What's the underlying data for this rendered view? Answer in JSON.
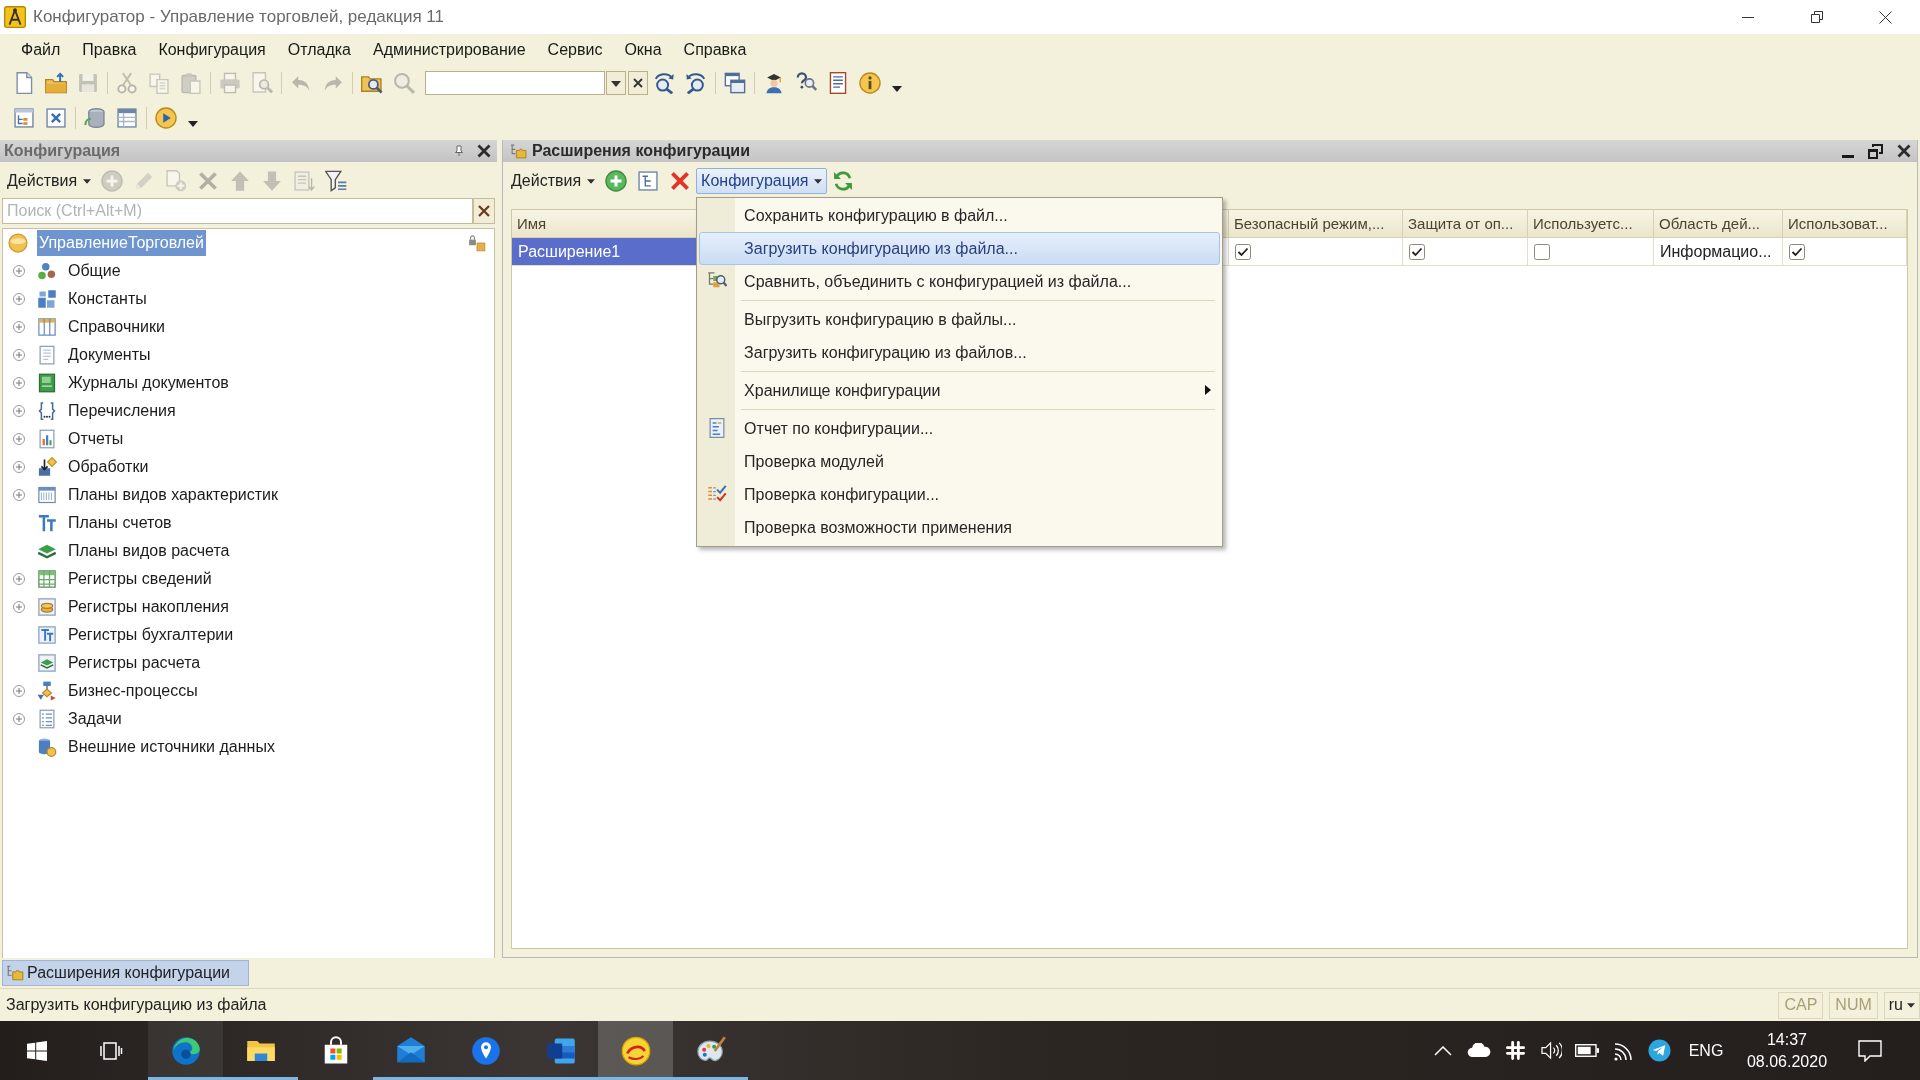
{
  "window": {
    "title": "Конфигуратор - Управление торговлей, редакция 11"
  },
  "menu_bar": [
    "Файл",
    "Правка",
    "Конфигурация",
    "Отладка",
    "Администрирование",
    "Сервис",
    "Окна",
    "Справка"
  ],
  "toolbar_main": [
    {
      "kind": "button",
      "disabled": false
    },
    {
      "kind": "button",
      "disabled": false
    },
    {
      "kind": "button",
      "disabled": true
    },
    {
      "kind": "separator"
    },
    {
      "kind": "button",
      "disabled": true
    },
    {
      "kind": "button",
      "disabled": true
    },
    {
      "kind": "button",
      "disabled": true
    },
    {
      "kind": "separator"
    },
    {
      "kind": "button",
      "disabled": true
    },
    {
      "kind": "button",
      "disabled": true
    },
    {
      "kind": "separator"
    },
    {
      "kind": "button",
      "disabled": true
    },
    {
      "kind": "button",
      "disabled": true
    },
    {
      "kind": "separator"
    },
    {
      "kind": "button",
      "disabled": false
    },
    {
      "kind": "button",
      "disabled": true
    },
    {
      "kind": "combo"
    },
    {
      "kind": "button",
      "disabled": false
    },
    {
      "kind": "button",
      "disabled": false
    },
    {
      "kind": "separator"
    },
    {
      "kind": "button",
      "disabled": false
    },
    {
      "kind": "separator"
    },
    {
      "kind": "button",
      "disabled": false
    },
    {
      "kind": "button",
      "disabled": false
    },
    {
      "kind": "button",
      "disabled": false
    },
    {
      "kind": "button",
      "disabled": false
    },
    {
      "kind": "menu_caret"
    }
  ],
  "toolbar_secondary": [
    {
      "kind": "button",
      "disabled": false
    },
    {
      "kind": "button",
      "disabled": false
    },
    {
      "kind": "separator"
    },
    {
      "kind": "button",
      "disabled": false
    },
    {
      "kind": "button",
      "disabled": false
    },
    {
      "kind": "separator"
    },
    {
      "kind": "button",
      "disabled": false
    },
    {
      "kind": "menu_caret"
    }
  ],
  "configuration_panel": {
    "title": "Конфигурация",
    "toolbar": [
      {
        "kind": "dropdown",
        "label": "Действия",
        "expanded": false
      },
      {
        "kind": "button",
        "disabled": true
      },
      {
        "kind": "button",
        "disabled": true
      },
      {
        "kind": "button",
        "disabled": true
      },
      {
        "kind": "button",
        "disabled": true
      },
      {
        "kind": "button",
        "disabled": true
      },
      {
        "kind": "button",
        "disabled": true
      },
      {
        "kind": "button",
        "disabled": true
      },
      {
        "kind": "button",
        "disabled": false
      }
    ],
    "search": {
      "placeholder": "Поиск (Ctrl+Alt+M)"
    },
    "tree": {
      "label": "УправлениеТорговлей",
      "selected": true,
      "children": [
        {
          "label": "Общие",
          "expandable": true,
          "selected": false
        },
        {
          "label": "Константы",
          "expandable": true,
          "selected": false
        },
        {
          "label": "Справочники",
          "expandable": true,
          "selected": false
        },
        {
          "label": "Документы",
          "expandable": true,
          "selected": false
        },
        {
          "label": "Журналы документов",
          "expandable": true,
          "selected": false
        },
        {
          "label": "Перечисления",
          "expandable": true,
          "selected": false
        },
        {
          "label": "Отчеты",
          "expandable": true,
          "selected": false
        },
        {
          "label": "Обработки",
          "expandable": true,
          "selected": false
        },
        {
          "label": "Планы видов характеристик",
          "expandable": true,
          "selected": false
        },
        {
          "label": "Планы счетов",
          "expandable": false,
          "selected": false
        },
        {
          "label": "Планы видов расчета",
          "expandable": false,
          "selected": false
        },
        {
          "label": "Регистры сведений",
          "expandable": true,
          "selected": false
        },
        {
          "label": "Регистры накопления",
          "expandable": true,
          "selected": false
        },
        {
          "label": "Регистры бухгалтерии",
          "expandable": false,
          "selected": false
        },
        {
          "label": "Регистры расчета",
          "expandable": false,
          "selected": false
        },
        {
          "label": "Бизнес-процессы",
          "expandable": true,
          "selected": false
        },
        {
          "label": "Задачи",
          "expandable": true,
          "selected": false
        },
        {
          "label": "Внешние источники данных",
          "expandable": false,
          "selected": false
        }
      ]
    }
  },
  "extensions_window": {
    "title": "Расширения конфигурации",
    "toolbar": [
      {
        "kind": "dropdown",
        "label": "Действия",
        "expanded": false
      },
      {
        "kind": "button",
        "disabled": false
      },
      {
        "kind": "button",
        "disabled": false
      },
      {
        "kind": "button",
        "disabled": false
      },
      {
        "kind": "dropdown",
        "label": "Конфигурация",
        "expanded": true
      },
      {
        "kind": "button",
        "disabled": false
      }
    ],
    "table": {
      "columns": [
        {
          "label": "Имя"
        },
        {
          "label": "Безопасный режим,..."
        },
        {
          "label": "Защита от оп..."
        },
        {
          "label": "Используетс..."
        },
        {
          "label": "Область дей..."
        },
        {
          "label": "Использоват..."
        }
      ],
      "rows": [
        {
          "cells": [
            {
              "kind": "text",
              "text": "Расширение1",
              "selected": true
            },
            {
              "kind": "checkbox",
              "checked": true,
              "selected": false
            },
            {
              "kind": "checkbox",
              "checked": true,
              "selected": false
            },
            {
              "kind": "checkbox",
              "checked": false,
              "selected": false
            },
            {
              "kind": "text",
              "text": "Информацио...",
              "selected": false
            },
            {
              "kind": "checkbox",
              "checked": true,
              "selected": false
            }
          ]
        }
      ]
    }
  },
  "configuration_menu": {
    "items": [
      {
        "kind": "item",
        "label": "Сохранить конфигурацию в файл...",
        "selected": false
      },
      {
        "kind": "item",
        "label": "Загрузить конфигурацию из файла...",
        "selected": true
      },
      {
        "kind": "item",
        "label": "Сравнить, объединить с конфигурацией из файла...",
        "selected": false
      },
      {
        "kind": "separator"
      },
      {
        "kind": "item",
        "label": "Выгрузить конфигурацию в файлы...",
        "selected": false
      },
      {
        "kind": "item",
        "label": "Загрузить конфигурацию из файлов...",
        "selected": false
      },
      {
        "kind": "separator"
      },
      {
        "kind": "submenu",
        "label": "Хранилище конфигурации",
        "selected": false
      },
      {
        "kind": "separator"
      },
      {
        "kind": "item",
        "label": "Отчет по конфигурации...",
        "selected": false
      },
      {
        "kind": "item",
        "label": "Проверка модулей",
        "selected": false
      },
      {
        "kind": "item",
        "label": "Проверка конфигурации...",
        "selected": false
      },
      {
        "kind": "item",
        "label": "Проверка возможности применения",
        "selected": false
      }
    ]
  },
  "window_tabs": [
    {
      "label": "Расширения конфигурации",
      "selected": true
    }
  ],
  "status_bar": {
    "message": "Загрузить конфигурацию из файла",
    "indicators": [
      {
        "label": "CAP",
        "on": false
      },
      {
        "label": "NUM",
        "on": false
      }
    ],
    "language": "ru"
  },
  "taskbar": {
    "apps": [
      {
        "running": true,
        "active": false,
        "hovered": true
      },
      {
        "running": true,
        "active": false,
        "hovered": false
      },
      {
        "running": false,
        "active": false,
        "hovered": false
      },
      {
        "running": true,
        "active": false,
        "hovered": false
      },
      {
        "running": true,
        "active": false,
        "hovered": false
      },
      {
        "running": true,
        "active": false,
        "hovered": false
      },
      {
        "running": true,
        "active": true,
        "hovered": false
      },
      {
        "running": true,
        "active": false,
        "hovered": false
      }
    ],
    "language": "ENG",
    "time": "14:37",
    "date": "08.06.2020"
  }
}
